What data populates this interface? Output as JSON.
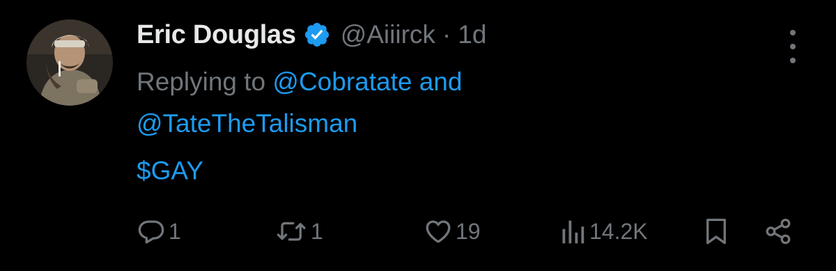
{
  "tweet": {
    "display_name": "Eric Douglas",
    "handle": "@Aiiirck",
    "separator": "·",
    "time": "1d",
    "replying_prefix": "Replying to",
    "reply_mention_1": "@Cobratate",
    "reply_and": "and",
    "reply_mention_2": "@TateTheTalisman",
    "text": "$GAY"
  },
  "actions": {
    "replies": "1",
    "retweets": "1",
    "likes": "19",
    "views": "14.2K"
  },
  "icons": {
    "verified": "verified-badge-icon",
    "more": "more-vertical-icon",
    "reply": "reply-bubble-icon",
    "retweet": "retweet-icon",
    "like": "heart-icon",
    "views": "bar-chart-icon",
    "bookmark": "bookmark-icon",
    "share": "share-icon"
  },
  "colors": {
    "background": "#000000",
    "primary_text": "#e7e9ea",
    "secondary_text": "#71767b",
    "accent": "#1d9bf0"
  }
}
